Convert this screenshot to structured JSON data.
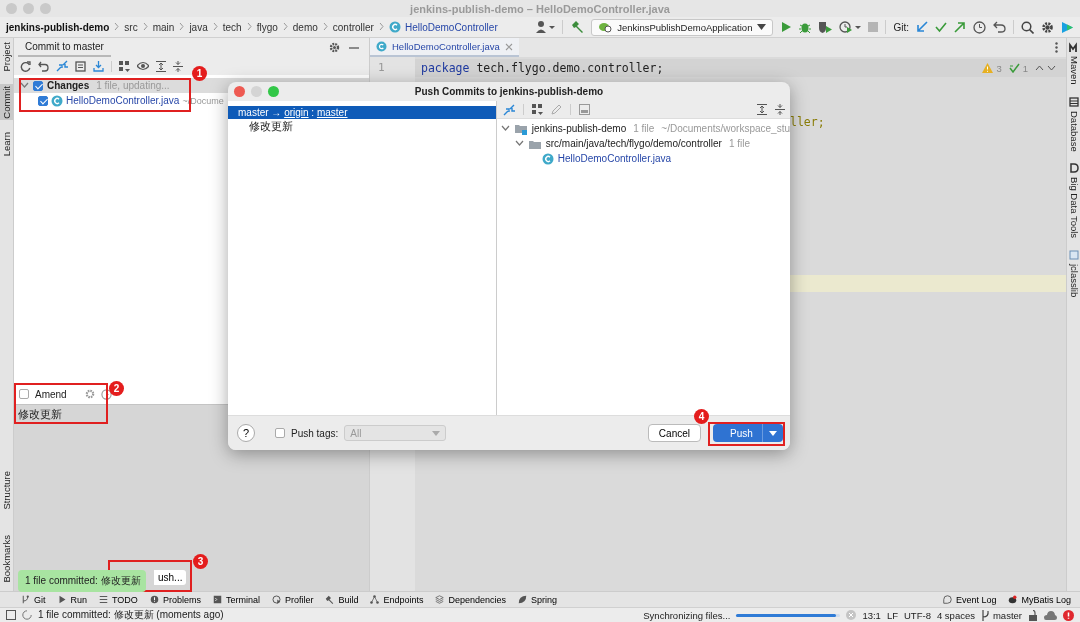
{
  "window": {
    "title": "jenkins-publish-demo – HelloDemoController.java"
  },
  "breadcrumbs": [
    {
      "label": "jenkins-publish-demo",
      "kind": "project"
    },
    {
      "label": "src",
      "kind": "folder"
    },
    {
      "label": "main",
      "kind": "folder"
    },
    {
      "label": "java",
      "kind": "folder"
    },
    {
      "label": "tech",
      "kind": "folder"
    },
    {
      "label": "flygo",
      "kind": "folder"
    },
    {
      "label": "demo",
      "kind": "folder"
    },
    {
      "label": "controller",
      "kind": "folder"
    },
    {
      "label": "HelloDemoController",
      "kind": "class"
    }
  ],
  "toolbar": {
    "run_config": "JenkinsPublishDemoApplication",
    "git_label": "Git:"
  },
  "left_stripe": {
    "top": [
      {
        "label": "Project",
        "selected": false
      },
      {
        "label": "Commit",
        "selected": true
      },
      {
        "label": "Learn",
        "selected": false
      }
    ],
    "bottom": [
      {
        "label": "Structure",
        "selected": false
      },
      {
        "label": "Bookmarks",
        "selected": false
      }
    ]
  },
  "commit_panel": {
    "tab": "Commit to master",
    "changes": {
      "label": "Changes",
      "note": "1 file, updating...",
      "checked": true,
      "expanded": true,
      "files": [
        {
          "name": "HelloDemoController.java",
          "path": "~/Docume",
          "checked": true
        }
      ]
    },
    "amend": {
      "label": "Amend",
      "checked": false
    },
    "message": "修改更新",
    "push_button": "ush..."
  },
  "editor": {
    "tab": "HelloDemoController.java",
    "line_numbers": [
      "1"
    ],
    "code": "package tech.flygo.demo.controller;",
    "fragment": "ller;",
    "warnings": "3",
    "typos": "1"
  },
  "right_stripe": [
    {
      "label": "Maven"
    },
    {
      "label": "Database"
    },
    {
      "label": "Big Data Tools"
    },
    {
      "label": "jclasslib"
    }
  ],
  "dialog": {
    "title": "Push Commits to jenkins-publish-demo",
    "branches": [
      {
        "source": "master",
        "arrow": "→",
        "remote": "origin",
        "separator": ":",
        "target": "master",
        "selected": true,
        "commits": [
          {
            "message": "修改更新",
            "selected": false
          }
        ]
      }
    ],
    "tree": [
      {
        "name": "jenkins-publish-demo",
        "kind": "module",
        "count": "1 file",
        "path": "~/Documents/workspace_stu",
        "expanded": true,
        "children": [
          {
            "name": "src/main/java/tech/flygo/demo/controller",
            "kind": "folder",
            "count": "1 file",
            "expanded": true,
            "children": [
              {
                "name": "HelloDemoController.java",
                "kind": "class"
              }
            ]
          }
        ]
      }
    ],
    "help": "?",
    "push_tags": {
      "label": "Push tags:",
      "checked": false,
      "value": "All",
      "disabled": true
    },
    "cancel": "Cancel",
    "push": "Push"
  },
  "annotations": [
    {
      "number": "1"
    },
    {
      "number": "2"
    },
    {
      "number": "3"
    },
    {
      "number": "4"
    }
  ],
  "toast": "1 file committed: 修改更新",
  "tool_windows": [
    {
      "label": "Git"
    },
    {
      "label": "Run"
    },
    {
      "label": "TODO"
    },
    {
      "label": "Problems"
    },
    {
      "label": "Terminal"
    },
    {
      "label": "Profiler"
    },
    {
      "label": "Build"
    },
    {
      "label": "Endpoints"
    },
    {
      "label": "Dependencies"
    },
    {
      "label": "Spring"
    }
  ],
  "tool_windows_right": [
    {
      "label": "Event Log"
    },
    {
      "label": "MyBatis Log"
    }
  ],
  "status_bar": {
    "message": "1 file committed: 修改更新 (moments ago)",
    "task": "Synchronizing files...",
    "progress": {
      "level": 0.96
    },
    "items": [
      "13:1",
      "LF",
      "UTF-8",
      "4 spaces"
    ],
    "branch": "master"
  }
}
